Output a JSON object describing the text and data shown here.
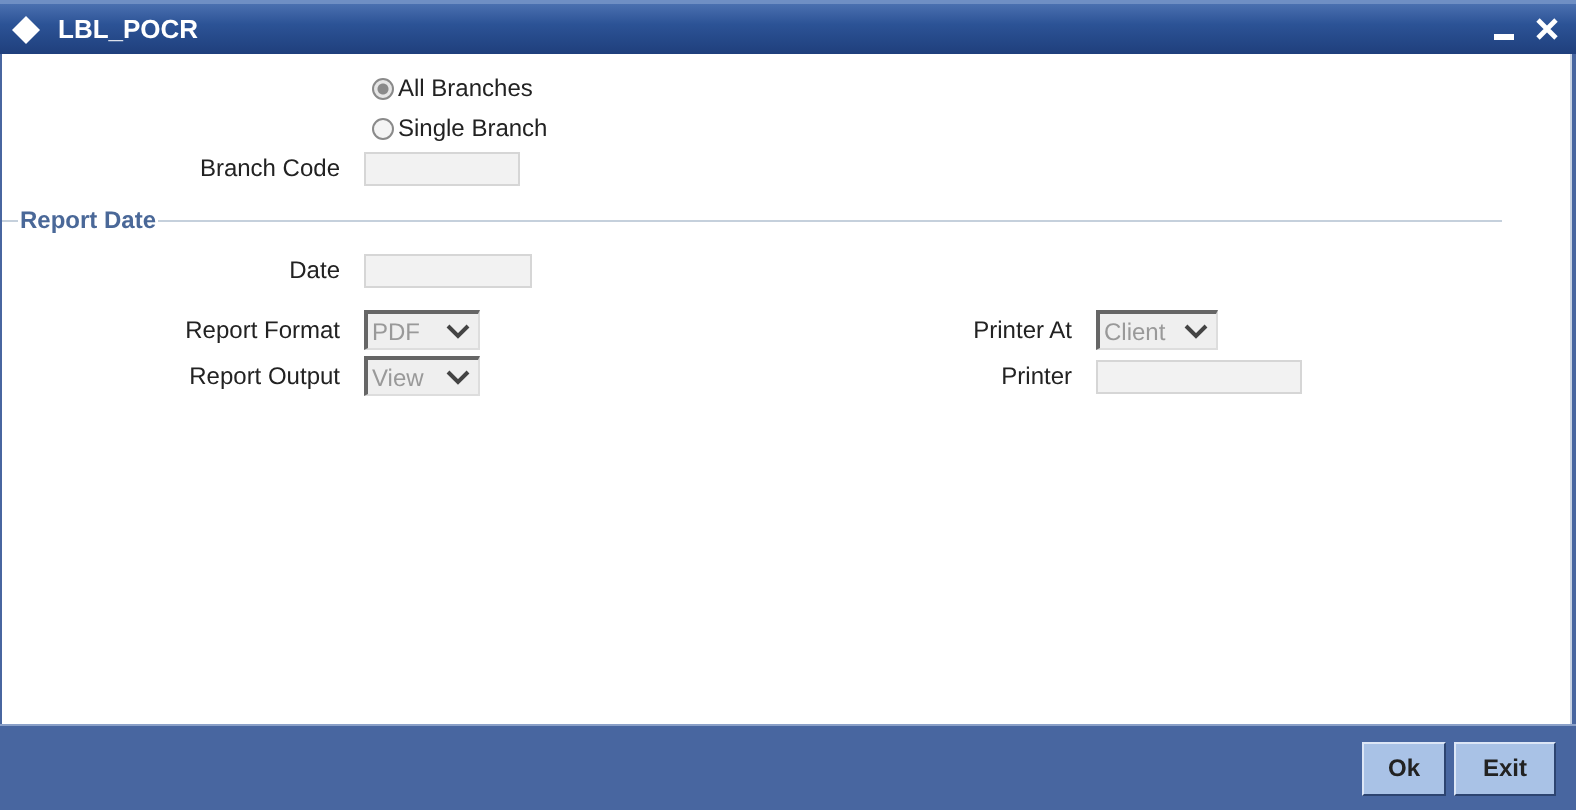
{
  "window": {
    "title": "LBL_POCR"
  },
  "branch_options": [
    {
      "label": "All Branches",
      "selected": true
    },
    {
      "label": "Single Branch",
      "selected": false
    }
  ],
  "branch_code": {
    "label": "Branch Code"
  },
  "report_date": {
    "heading": "Report Date",
    "date": {
      "label": "Date"
    },
    "report_format": {
      "label": "Report Format",
      "value": "PDF"
    },
    "report_output": {
      "label": "Report Output",
      "value": "View"
    },
    "printer_at": {
      "label": "Printer At",
      "value": "Client"
    },
    "printer": {
      "label": "Printer"
    }
  },
  "buttons": [
    {
      "label": "Ok"
    },
    {
      "label": "Exit"
    }
  ]
}
